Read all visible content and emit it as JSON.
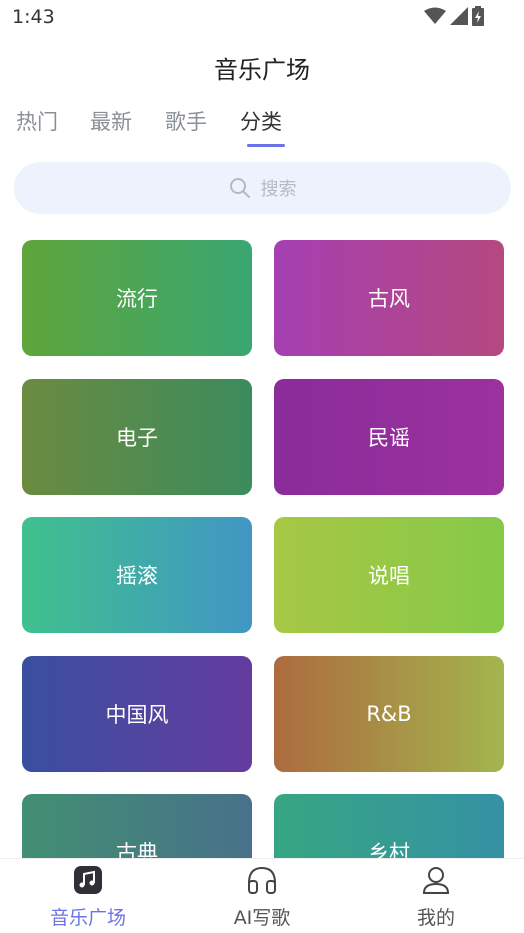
{
  "status_bar": {
    "time": "1:43"
  },
  "header": {
    "title": "音乐广场"
  },
  "tabs": [
    {
      "label": "热门"
    },
    {
      "label": "最新"
    },
    {
      "label": "歌手"
    },
    {
      "label": "分类"
    }
  ],
  "search": {
    "placeholder": "搜索"
  },
  "categories": [
    {
      "label": "流行",
      "colors": [
        "#5ea53a",
        "#3aa672"
      ]
    },
    {
      "label": "古风",
      "colors": [
        "#a640b3",
        "#b4487f"
      ]
    },
    {
      "label": "电子",
      "colors": [
        "#6b8b40",
        "#3c8b5d"
      ]
    },
    {
      "label": "民谣",
      "colors": [
        "#8a2c9a",
        "#9c31a0"
      ]
    },
    {
      "label": "摇滚",
      "colors": [
        "#3fc18d",
        "#4196c4"
      ]
    },
    {
      "label": "说唱",
      "colors": [
        "#a7c845",
        "#86c948"
      ]
    },
    {
      "label": "中国风",
      "colors": [
        "#394f9f",
        "#643c9f"
      ]
    },
    {
      "label": "R&B",
      "colors": [
        "#ad6b3e",
        "#a3b54e"
      ]
    },
    {
      "label": "古典",
      "colors": [
        "#428f73",
        "#48718a"
      ]
    },
    {
      "label": "乡村",
      "colors": [
        "#36a682",
        "#3591a4"
      ]
    }
  ],
  "bottom_nav": [
    {
      "label": "音乐广场",
      "icon": "music-note-icon"
    },
    {
      "label": "AI写歌",
      "icon": "headphones-icon"
    },
    {
      "label": "我的",
      "icon": "user-icon"
    }
  ],
  "colors": {
    "accent": "#6b73e6",
    "search_bg": "#eef2fd"
  }
}
